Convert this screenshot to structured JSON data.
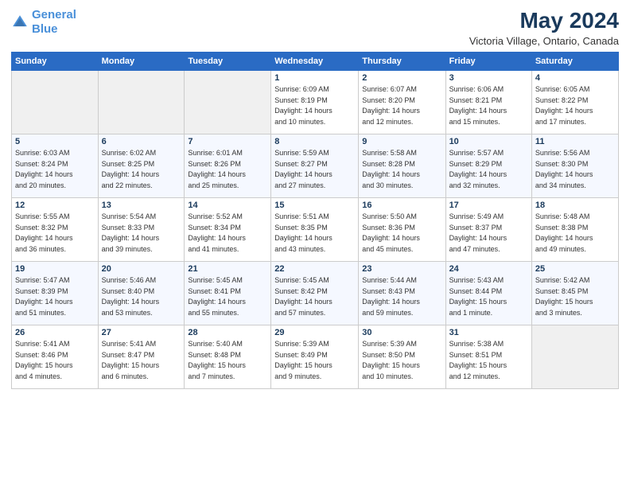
{
  "logo": {
    "line1": "General",
    "line2": "Blue"
  },
  "title": "May 2024",
  "subtitle": "Victoria Village, Ontario, Canada",
  "days_header": [
    "Sunday",
    "Monday",
    "Tuesday",
    "Wednesday",
    "Thursday",
    "Friday",
    "Saturday"
  ],
  "weeks": [
    [
      {
        "num": "",
        "info": ""
      },
      {
        "num": "",
        "info": ""
      },
      {
        "num": "",
        "info": ""
      },
      {
        "num": "1",
        "info": "Sunrise: 6:09 AM\nSunset: 8:19 PM\nDaylight: 14 hours\nand 10 minutes."
      },
      {
        "num": "2",
        "info": "Sunrise: 6:07 AM\nSunset: 8:20 PM\nDaylight: 14 hours\nand 12 minutes."
      },
      {
        "num": "3",
        "info": "Sunrise: 6:06 AM\nSunset: 8:21 PM\nDaylight: 14 hours\nand 15 minutes."
      },
      {
        "num": "4",
        "info": "Sunrise: 6:05 AM\nSunset: 8:22 PM\nDaylight: 14 hours\nand 17 minutes."
      }
    ],
    [
      {
        "num": "5",
        "info": "Sunrise: 6:03 AM\nSunset: 8:24 PM\nDaylight: 14 hours\nand 20 minutes."
      },
      {
        "num": "6",
        "info": "Sunrise: 6:02 AM\nSunset: 8:25 PM\nDaylight: 14 hours\nand 22 minutes."
      },
      {
        "num": "7",
        "info": "Sunrise: 6:01 AM\nSunset: 8:26 PM\nDaylight: 14 hours\nand 25 minutes."
      },
      {
        "num": "8",
        "info": "Sunrise: 5:59 AM\nSunset: 8:27 PM\nDaylight: 14 hours\nand 27 minutes."
      },
      {
        "num": "9",
        "info": "Sunrise: 5:58 AM\nSunset: 8:28 PM\nDaylight: 14 hours\nand 30 minutes."
      },
      {
        "num": "10",
        "info": "Sunrise: 5:57 AM\nSunset: 8:29 PM\nDaylight: 14 hours\nand 32 minutes."
      },
      {
        "num": "11",
        "info": "Sunrise: 5:56 AM\nSunset: 8:30 PM\nDaylight: 14 hours\nand 34 minutes."
      }
    ],
    [
      {
        "num": "12",
        "info": "Sunrise: 5:55 AM\nSunset: 8:32 PM\nDaylight: 14 hours\nand 36 minutes."
      },
      {
        "num": "13",
        "info": "Sunrise: 5:54 AM\nSunset: 8:33 PM\nDaylight: 14 hours\nand 39 minutes."
      },
      {
        "num": "14",
        "info": "Sunrise: 5:52 AM\nSunset: 8:34 PM\nDaylight: 14 hours\nand 41 minutes."
      },
      {
        "num": "15",
        "info": "Sunrise: 5:51 AM\nSunset: 8:35 PM\nDaylight: 14 hours\nand 43 minutes."
      },
      {
        "num": "16",
        "info": "Sunrise: 5:50 AM\nSunset: 8:36 PM\nDaylight: 14 hours\nand 45 minutes."
      },
      {
        "num": "17",
        "info": "Sunrise: 5:49 AM\nSunset: 8:37 PM\nDaylight: 14 hours\nand 47 minutes."
      },
      {
        "num": "18",
        "info": "Sunrise: 5:48 AM\nSunset: 8:38 PM\nDaylight: 14 hours\nand 49 minutes."
      }
    ],
    [
      {
        "num": "19",
        "info": "Sunrise: 5:47 AM\nSunset: 8:39 PM\nDaylight: 14 hours\nand 51 minutes."
      },
      {
        "num": "20",
        "info": "Sunrise: 5:46 AM\nSunset: 8:40 PM\nDaylight: 14 hours\nand 53 minutes."
      },
      {
        "num": "21",
        "info": "Sunrise: 5:45 AM\nSunset: 8:41 PM\nDaylight: 14 hours\nand 55 minutes."
      },
      {
        "num": "22",
        "info": "Sunrise: 5:45 AM\nSunset: 8:42 PM\nDaylight: 14 hours\nand 57 minutes."
      },
      {
        "num": "23",
        "info": "Sunrise: 5:44 AM\nSunset: 8:43 PM\nDaylight: 14 hours\nand 59 minutes."
      },
      {
        "num": "24",
        "info": "Sunrise: 5:43 AM\nSunset: 8:44 PM\nDaylight: 15 hours\nand 1 minute."
      },
      {
        "num": "25",
        "info": "Sunrise: 5:42 AM\nSunset: 8:45 PM\nDaylight: 15 hours\nand 3 minutes."
      }
    ],
    [
      {
        "num": "26",
        "info": "Sunrise: 5:41 AM\nSunset: 8:46 PM\nDaylight: 15 hours\nand 4 minutes."
      },
      {
        "num": "27",
        "info": "Sunrise: 5:41 AM\nSunset: 8:47 PM\nDaylight: 15 hours\nand 6 minutes."
      },
      {
        "num": "28",
        "info": "Sunrise: 5:40 AM\nSunset: 8:48 PM\nDaylight: 15 hours\nand 7 minutes."
      },
      {
        "num": "29",
        "info": "Sunrise: 5:39 AM\nSunset: 8:49 PM\nDaylight: 15 hours\nand 9 minutes."
      },
      {
        "num": "30",
        "info": "Sunrise: 5:39 AM\nSunset: 8:50 PM\nDaylight: 15 hours\nand 10 minutes."
      },
      {
        "num": "31",
        "info": "Sunrise: 5:38 AM\nSunset: 8:51 PM\nDaylight: 15 hours\nand 12 minutes."
      },
      {
        "num": "",
        "info": ""
      }
    ]
  ]
}
